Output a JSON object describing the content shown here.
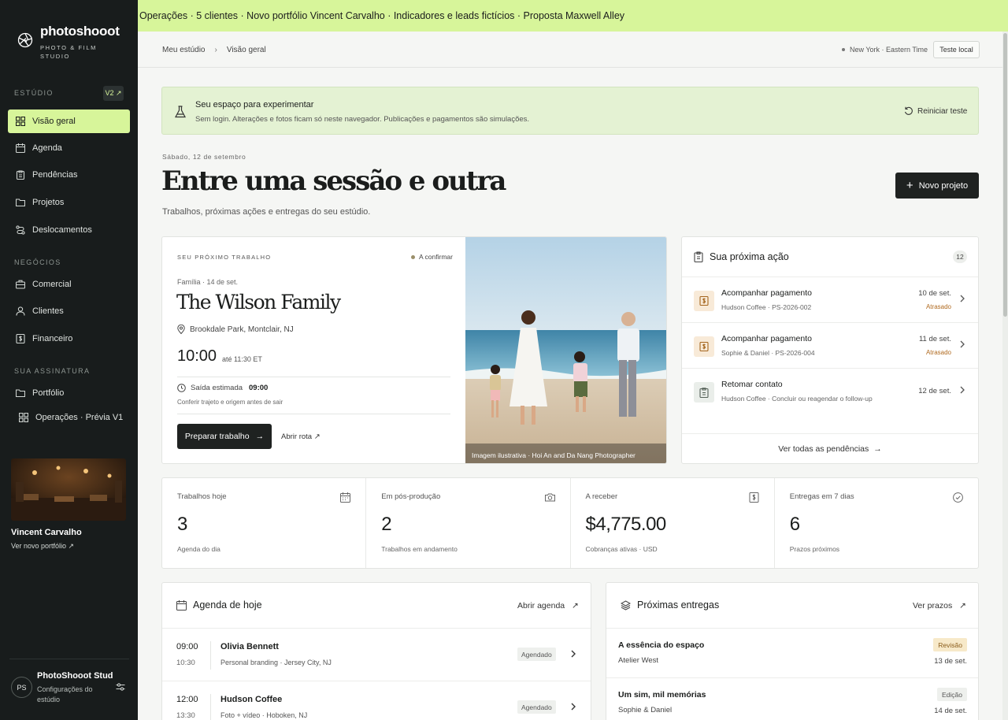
{
  "banner": "Operações · 5 clientes · Novo portfólio Vincent Carvalho · Indicadores e leads fictícios · Proposta Maxwell Alley",
  "brand": {
    "name": "photoshooot",
    "sub": "PHOTO & FILM STUDIO"
  },
  "sidebar": {
    "section_studio": "ESTÚDIO",
    "version_badge": "V2 ↗",
    "studio_items": [
      {
        "label": "Visão geral",
        "icon": "grid-icon",
        "active": true
      },
      {
        "label": "Agenda",
        "icon": "calendar-icon"
      },
      {
        "label": "Pendências",
        "icon": "clipboard-icon"
      },
      {
        "label": "Projetos",
        "icon": "folder-icon"
      },
      {
        "label": "Deslocamentos",
        "icon": "route-icon"
      }
    ],
    "section_business": "NEGÓCIOS",
    "business_items": [
      {
        "label": "Comercial",
        "icon": "briefcase-icon"
      },
      {
        "label": "Clientes",
        "icon": "user-icon"
      },
      {
        "label": "Financeiro",
        "icon": "dollar-icon"
      }
    ],
    "section_subscription": "SUA ASSINATURA",
    "subscription_items": [
      {
        "label": "Portfólio",
        "icon": "folder-icon"
      },
      {
        "label": "Operações · Prévia V1",
        "icon": "grid-icon"
      }
    ],
    "portfolio_name": "Vincent Carvalho",
    "portfolio_link": "Ver novo portfólio ↗",
    "user_initials": "PS",
    "user_name": "PhotoShooot Stud...",
    "user_sub": "Configurações do estúdio"
  },
  "header": {
    "crumb_root": "Meu estúdio",
    "crumb_current": "Visão geral",
    "timezone": "New York · Eastern Time",
    "local_button": "Teste local"
  },
  "test_banner": {
    "title": "Seu espaço para experimentar",
    "desc": "Sem login. Alterações e fotos ficam só neste navegador. Publicações e pagamentos são simulações.",
    "reset": "Reiniciar teste"
  },
  "page": {
    "date": "Sábado, 12 de setembro",
    "title": "Entre uma sessão e outra",
    "subtitle": "Trabalhos, próximas ações e entregas do seu estúdio.",
    "new_project": "Novo projeto"
  },
  "next_job": {
    "label": "SEU PRÓXIMO TRABALHO",
    "status": "A confirmar",
    "meta": "Família · 14 de set.",
    "client": "The Wilson Family",
    "place": "Brookdale Park, Montclair, NJ",
    "time": "10:00",
    "until": "até 11:30 ET",
    "depart_label": "Saída estimada",
    "depart_time": "09:00",
    "depart_note": "Conferir trajeto e origem antes de sair",
    "prep_button": "Preparar trabalho",
    "route_link": "Abrir rota ↗",
    "photo_caption": "Imagem ilustrativa · Hoi An and Da Nang Photographer"
  },
  "next_action": {
    "title": "Sua próxima ação",
    "count": "12",
    "items": [
      {
        "title": "Acompanhar pagamento",
        "sub": "Hudson Coffee · PS-2026-002",
        "date": "10 de set.",
        "late": "Atrasado",
        "icon": "dollar-icon"
      },
      {
        "title": "Acompanhar pagamento",
        "sub": "Sophie & Daniel · PS-2026-004",
        "date": "11 de set.",
        "late": "Atrasado",
        "icon": "dollar-icon"
      },
      {
        "title": "Retomar contato",
        "sub": "Hudson Coffee · Concluir ou reagendar o follow-up",
        "date": "12 de set.",
        "late": "",
        "icon": "clipboard-icon"
      }
    ],
    "see_all": "Ver todas as pendências"
  },
  "stats": [
    {
      "label": "Trabalhos hoje",
      "value": "3",
      "sub": "Agenda do dia",
      "icon": "calendar-icon"
    },
    {
      "label": "Em pós-produção",
      "value": "2",
      "sub": "Trabalhos em andamento",
      "icon": "camera-icon"
    },
    {
      "label": "A receber",
      "value": "$4,775.00",
      "sub": "Cobranças ativas · USD",
      "icon": "dollar-icon"
    },
    {
      "label": "Entregas em 7 dias",
      "value": "6",
      "sub": "Prazos próximos",
      "icon": "check-circle-icon"
    }
  ],
  "agenda": {
    "title": "Agenda de hoje",
    "link": "Abrir agenda",
    "rows": [
      {
        "start": "09:00",
        "end": "10:30",
        "name": "Olivia Bennett",
        "sub": "Personal branding · Jersey City, NJ",
        "badge": "Agendado"
      },
      {
        "start": "12:00",
        "end": "13:30",
        "name": "Hudson Coffee",
        "sub": "Foto + vídeo · Hoboken, NJ",
        "badge": "Agendado"
      }
    ]
  },
  "deliveries": {
    "title": "Próximas entregas",
    "link": "Ver prazos",
    "rows": [
      {
        "name": "A essência do espaço",
        "client": "Atelier West",
        "badge": "Revisão",
        "date": "13 de set."
      },
      {
        "name": "Um sim, mil memórias",
        "client": "Sophie & Daniel",
        "badge": "Edição",
        "date": "14 de set."
      }
    ]
  },
  "colors": {
    "accent": "#d7f59a",
    "sidebar": "#181c1c",
    "late": "#b06a1f",
    "review_badge": "#f7e9c9"
  }
}
